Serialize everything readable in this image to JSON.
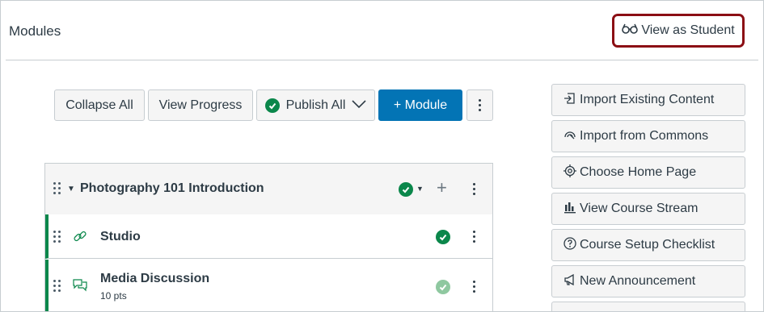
{
  "header": {
    "title": "Modules",
    "view_as_student_label": "View as Student"
  },
  "toolbar": {
    "collapse_all": "Collapse All",
    "view_progress": "View Progress",
    "publish_all": "Publish All",
    "add_module": "+ Module"
  },
  "module": {
    "title": "Photography 101 Introduction",
    "items": [
      {
        "title": "Studio",
        "type": "link",
        "sub": "",
        "published": true
      },
      {
        "title": "Media Discussion",
        "type": "discussion",
        "sub": "10 pts",
        "published": true
      }
    ]
  },
  "sidebar": {
    "items": [
      {
        "label": "Import Existing Content",
        "icon": "import-icon"
      },
      {
        "label": "Import from Commons",
        "icon": "commons-icon"
      },
      {
        "label": "Choose Home Page",
        "icon": "target-icon"
      },
      {
        "label": "View Course Stream",
        "icon": "bar-chart-icon"
      },
      {
        "label": "Course Setup Checklist",
        "icon": "question-circle-icon"
      },
      {
        "label": "New Announcement",
        "icon": "megaphone-icon"
      }
    ]
  },
  "colors": {
    "primary": "#0374b5",
    "success": "#0b874b",
    "highlight": "#8b0e14"
  }
}
